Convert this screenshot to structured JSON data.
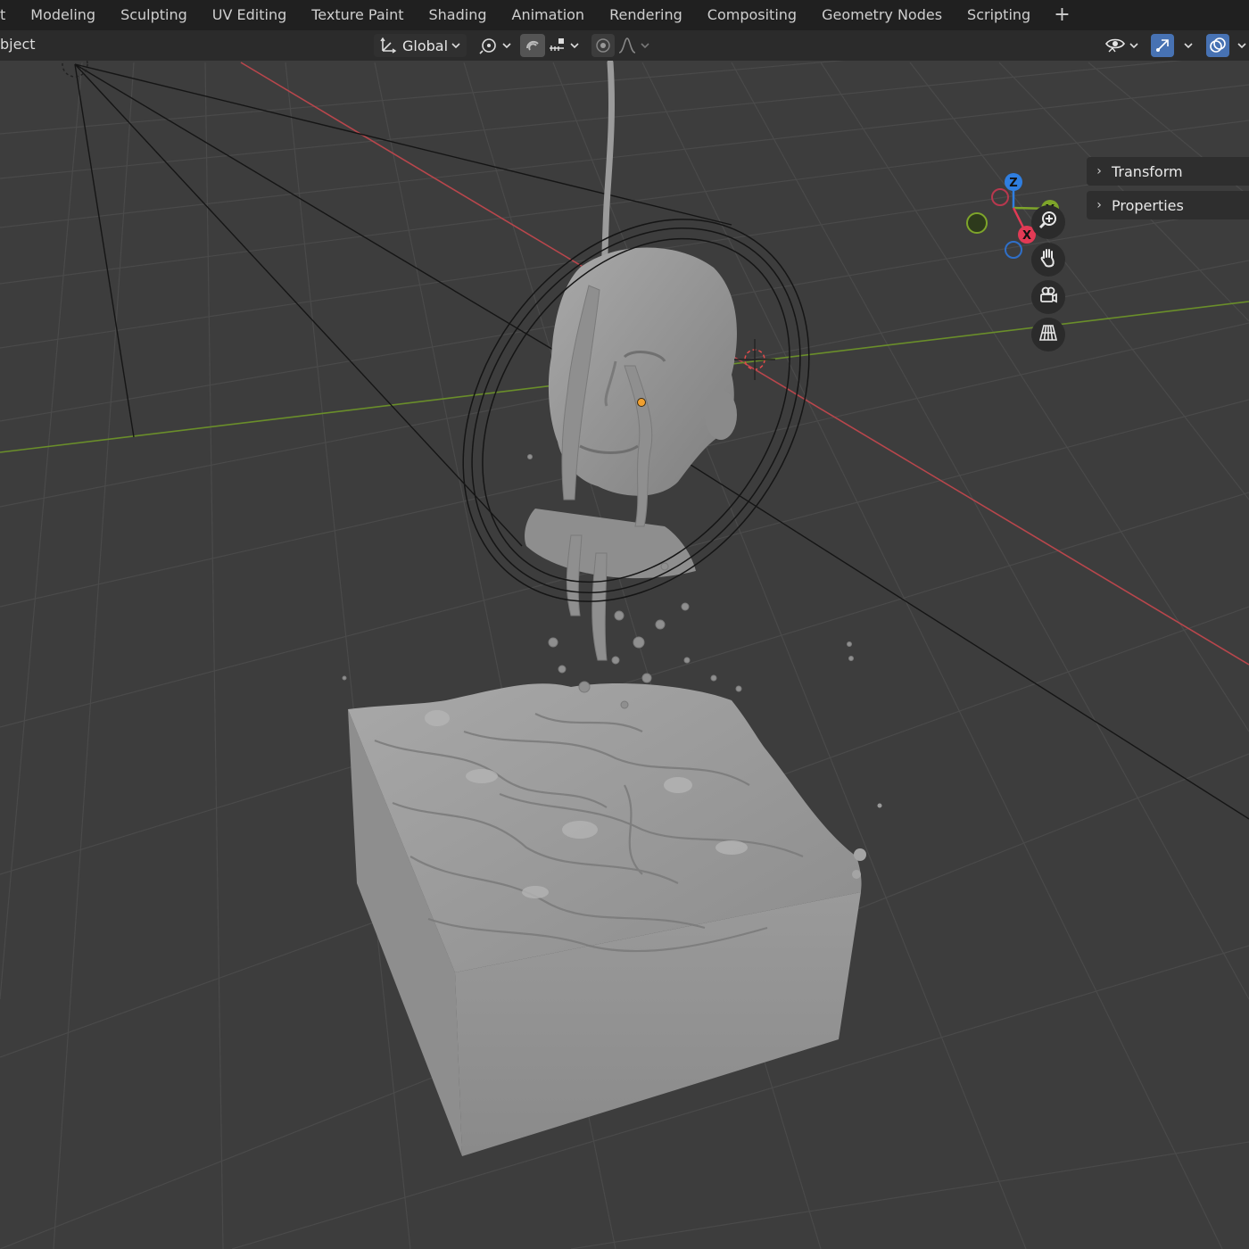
{
  "workspace_tabs": [
    "t",
    "Modeling",
    "Sculpting",
    "UV Editing",
    "Texture Paint",
    "Shading",
    "Animation",
    "Rendering",
    "Compositing",
    "Geometry Nodes",
    "Scripting"
  ],
  "add_workspace_symbol": "+",
  "header": {
    "mode_label": "bject",
    "transform_orientation": "Global",
    "pivot_icon": "pivot-point-icon",
    "snap_icon": "snap-magnet-icon",
    "snap_target_icon": "snap-increment-icon",
    "proportional_icon": "proportional-editing-icon",
    "falloff_icon": "falloff-curve-icon",
    "visibility_icon": "eye-icon",
    "gizmo_toggle_icon": "gizmo-icon",
    "overlay_toggle_icon": "overlay-icon"
  },
  "sidebar": {
    "panels": [
      {
        "label": "Transform",
        "collapsed": true
      },
      {
        "label": "Properties",
        "collapsed": true
      }
    ]
  },
  "nav_gizmo": {
    "axes": [
      {
        "label": "Z",
        "color": "#2f7ee0"
      },
      {
        "label": "Y",
        "color": "#7ea52a"
      },
      {
        "label": "X",
        "color": "#e23a55"
      }
    ],
    "buttons": [
      "zoom-icon",
      "pan-hand-icon",
      "camera-view-icon",
      "perspective-grid-icon"
    ]
  },
  "colors": {
    "background": "#3d3d3d",
    "topbar": "#202020",
    "header": "#2b2b2b",
    "x_axis_line": "#b8464c",
    "y_axis_line": "#6a8e2a",
    "mesh": "#9a9a9a",
    "selection_dot": "#f0a030"
  }
}
